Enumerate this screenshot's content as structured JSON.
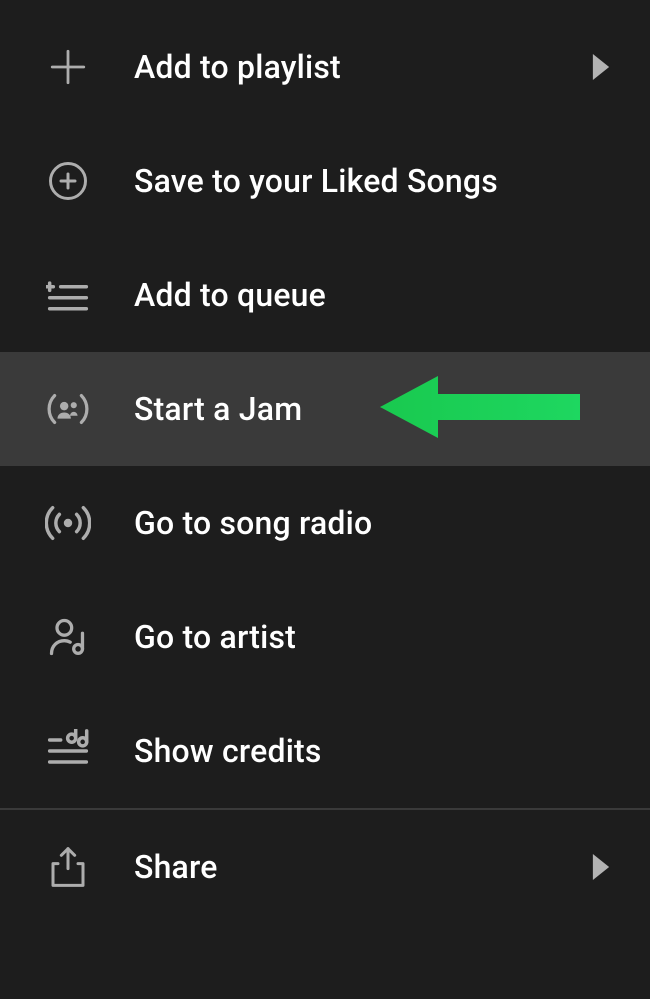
{
  "menu": {
    "items": [
      {
        "label": "Add to playlist"
      },
      {
        "label": "Save to your Liked Songs"
      },
      {
        "label": "Add to queue"
      },
      {
        "label": "Start a Jam"
      },
      {
        "label": "Go to song radio"
      },
      {
        "label": "Go to artist"
      },
      {
        "label": "Show credits"
      },
      {
        "label": "Share"
      }
    ]
  },
  "annotation": {
    "arrow_color": "#1ed760"
  }
}
